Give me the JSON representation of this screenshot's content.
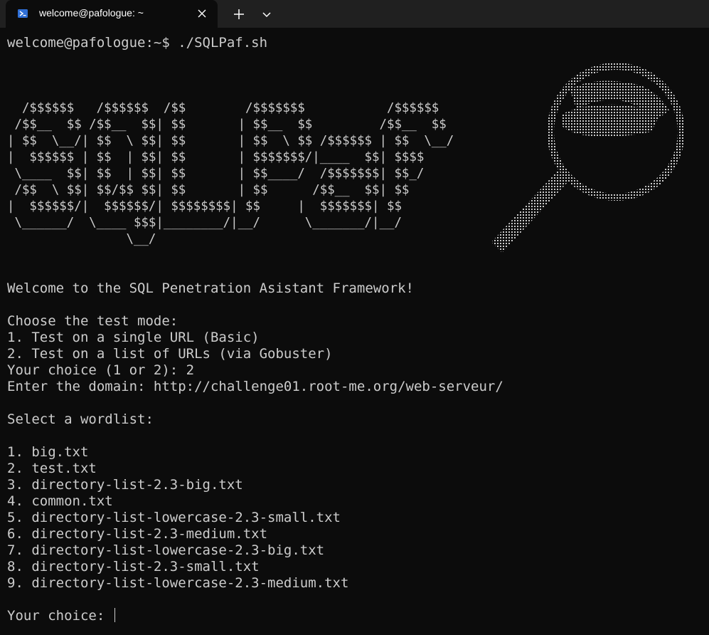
{
  "window": {
    "tab_title": "welcome@pafologue: ~",
    "tab_icon": "powershell-icon",
    "new_tab_icon": "plus-icon",
    "dropdown_icon": "chevron-down-icon",
    "close_icon": "close-icon"
  },
  "terminal": {
    "prompt": "welcome@pafologue:~$ ./SQLPaf.sh",
    "banner": "  /$$$$$$   /$$$$$$  /$$        /$$$$$$$           /$$$$$$ \n /$$__  $$ /$$__  $$| $$       | $$__  $$         /$$__  $$\n| $$  \\__/| $$  \\ $$| $$       | $$  \\ $$ /$$$$$$ | $$  \\__/\n|  $$$$$$ | $$  | $$| $$       | $$$$$$$/|____  $$| $$$$    \n \\____  $$| $$  | $$| $$       | $$____/  /$$$$$$$| $$_/    \n /$$  \\ $$| $$/$$ $$| $$       | $$      /$$__  $$| $$      \n|  $$$$$$/|  $$$$$$/| $$$$$$$$| $$     |  $$$$$$$| $$      \n \\______/  \\____ $$$|________/|__/      \\_______/|__/      \n                \\__/                                        ",
    "welcome": "Welcome to the SQL Penetration Asistant Framework!",
    "choose_mode": "Choose the test mode:",
    "mode_1": "1. Test on a single URL (Basic)",
    "mode_2": "2. Test on a list of URLs (via Gobuster)",
    "choice_prompt": "Your choice (1 or 2): 2",
    "domain_prompt": "Enter the domain: http://challenge01.root-me.org/web-serveur/",
    "select_wordlist": "Select a wordlist:",
    "wordlists": [
      "1. big.txt",
      "2. test.txt",
      "3. directory-list-2.3-big.txt",
      "4. common.txt",
      "5. directory-list-lowercase-2.3-small.txt",
      "6. directory-list-2.3-medium.txt",
      "7. directory-list-lowercase-2.3-big.txt",
      "8. directory-list-2.3-small.txt",
      "9. directory-list-lowercase-2.3-medium.txt"
    ],
    "final_prompt": "Your choice: "
  },
  "logo_icon": "magnifying-glass-ascii-icon",
  "colors": {
    "background": "#0c0c0c",
    "titlebar": "#202020",
    "text": "#cccccc",
    "icon_blue": "#2f6fd6"
  }
}
